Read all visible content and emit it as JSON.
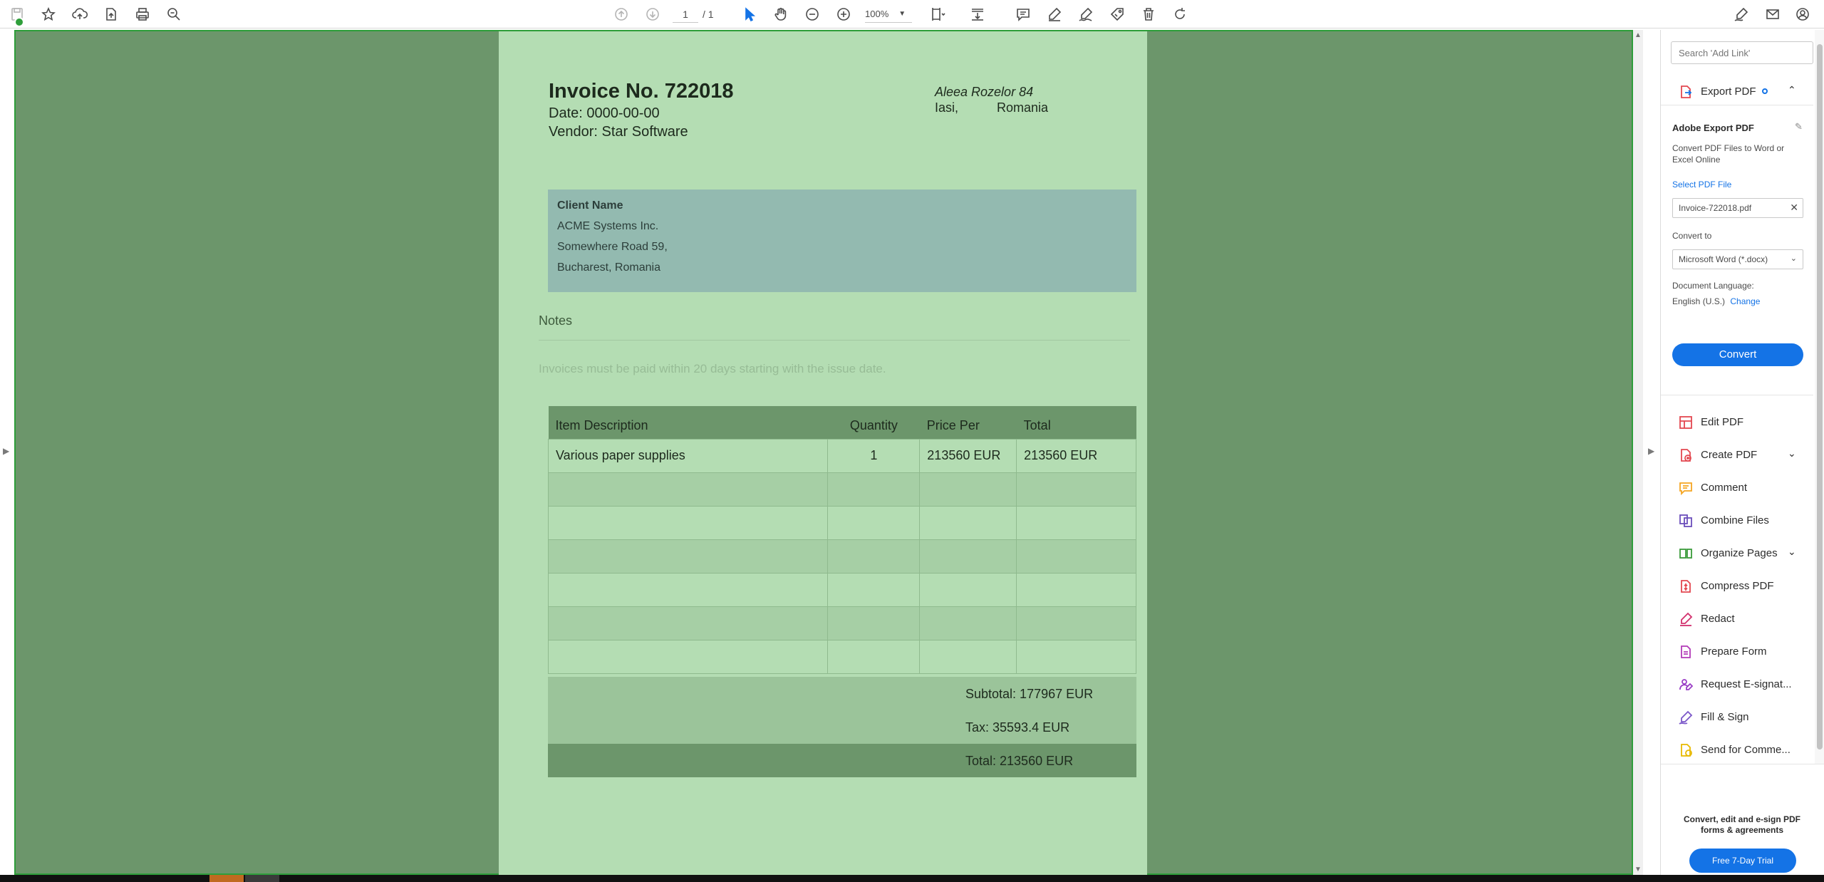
{
  "toolbar": {
    "page_current": "1",
    "page_total": "/ 1",
    "zoom": "100%"
  },
  "invoice": {
    "title": "Invoice No. 722018",
    "date": "Date: 0000-00-00",
    "vendor": "Vendor: Star Software",
    "address_line1": "Aleea Rozelor 84",
    "address_city": "Iasi,",
    "address_country": "Romania",
    "client": {
      "label": "Client Name",
      "name": "ACME Systems Inc.",
      "street": "Somewhere Road 59,",
      "city": "Bucharest, Romania"
    },
    "notes_heading": "Notes",
    "notes_text": "Invoices must be paid within 20 days starting with the issue date.",
    "table": {
      "headers": [
        "Item Description",
        "Quantity",
        "Price Per",
        "Total"
      ],
      "rows": [
        [
          "Various paper supplies",
          "1",
          "213560 EUR",
          "213560 EUR"
        ]
      ]
    },
    "subtotal": "Subtotal: 177967 EUR",
    "tax": "Tax: 35593.4 EUR",
    "total": "Total: 213560 EUR"
  },
  "right_panel": {
    "search_placeholder": "Search 'Add Link'",
    "export_header": "Export PDF",
    "aep_title": "Adobe Export PDF",
    "aep_desc": "Convert PDF Files to Word or Excel Online",
    "select_file": "Select PDF File",
    "file_name": "Invoice-722018.pdf",
    "convert_to_label": "Convert to",
    "convert_to_value": "Microsoft Word (*.docx)",
    "doc_lang_label": "Document Language:",
    "doc_lang_value": "English (U.S.)",
    "doc_lang_change": "Change",
    "convert_button": "Convert",
    "tools": [
      {
        "label": "Edit PDF",
        "color": "#e34850",
        "icon": "edit-pdf-icon"
      },
      {
        "label": "Create PDF",
        "color": "#e34850",
        "icon": "create-pdf-icon"
      },
      {
        "label": "Comment",
        "color": "#f5a623",
        "icon": "comment-icon"
      },
      {
        "label": "Combine Files",
        "color": "#6b4fbb",
        "icon": "combine-files-icon"
      },
      {
        "label": "Organize Pages",
        "color": "#3a9b3a",
        "icon": "organize-pages-icon"
      },
      {
        "label": "Compress PDF",
        "color": "#e34850",
        "icon": "compress-pdf-icon"
      },
      {
        "label": "Redact",
        "color": "#d2306d",
        "icon": "redact-icon"
      },
      {
        "label": "Prepare Form",
        "color": "#b33bb8",
        "icon": "prepare-form-icon"
      },
      {
        "label": "Request E-signat...",
        "color": "#9a3fc6",
        "icon": "request-esign-icon"
      },
      {
        "label": "Fill & Sign",
        "color": "#7b57c9",
        "icon": "fill-sign-icon"
      },
      {
        "label": "Send for Comme...",
        "color": "#e8b900",
        "icon": "send-for-comment-icon"
      }
    ],
    "promo_text": "Convert, edit and e-sign PDF forms & agreements",
    "trial_button": "Free 7-Day Trial"
  },
  "colors": {
    "doc_bg": "#6c966b",
    "page_bg": "#b4ddb3",
    "client_box": "#93bab0",
    "accent_blue": "#1473e6",
    "focus_green": "#2e9e3a"
  }
}
